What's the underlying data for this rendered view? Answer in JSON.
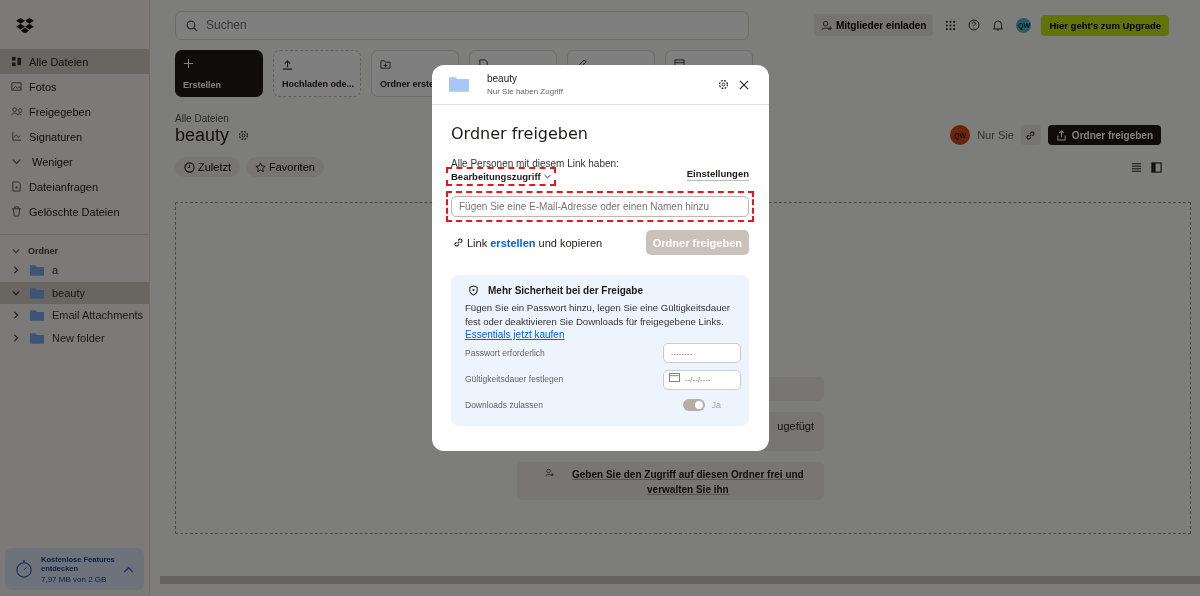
{
  "search": {
    "placeholder": "Suchen"
  },
  "top_actions": {
    "invite": "Mitglieder einladen",
    "avatar": "QW",
    "upgrade": "Hier geht's zum Upgrade"
  },
  "sidebar": {
    "nav": [
      {
        "label": "Alle Dateien",
        "selected": true
      },
      {
        "label": "Fotos",
        "selected": false
      },
      {
        "label": "Freigegeben",
        "selected": false
      },
      {
        "label": "Signaturen",
        "selected": false
      },
      {
        "label": "Weniger",
        "selected": false
      },
      {
        "label": "Dateianfragen",
        "selected": false
      },
      {
        "label": "Gelöschte Dateien",
        "selected": false
      }
    ],
    "folders_heading": "Ordner",
    "folders": [
      {
        "label": "a",
        "selected": false,
        "expanded": false
      },
      {
        "label": "beauty",
        "selected": true,
        "expanded": true
      },
      {
        "label": "Email Attachments",
        "selected": false,
        "expanded": false
      },
      {
        "label": "New folder",
        "selected": false,
        "expanded": false
      }
    ],
    "promo": {
      "title": "Kostenlose Features entdecken",
      "usage": "7,97 MB von 2 GB"
    }
  },
  "create_tiles": [
    {
      "label": "Erstellen",
      "kind": "primary"
    },
    {
      "label": "Hochladen ode...",
      "kind": "dashed"
    },
    {
      "label": "Ordner erste",
      "kind": "outline"
    },
    {
      "kind": "outline"
    },
    {
      "kind": "outline"
    },
    {
      "kind": "outline"
    }
  ],
  "breadcrumb": "Alle Dateien",
  "folder_title": "beauty",
  "sharing": {
    "avatar": "QW",
    "label": "Nur Sie",
    "button": "Ordner freigeben"
  },
  "filters": [
    {
      "label": "Zuletzt"
    },
    {
      "label": "Favoriten"
    }
  ],
  "empty_state": {
    "cards": [
      {
        "kind": "blank"
      },
      {
        "kind": "partial",
        "text": "ugefügt"
      },
      {
        "kind": "share",
        "text": "Geben Sie den Zugriff auf diesen Ordner frei und verwalten Sie ihn"
      }
    ]
  },
  "dialog": {
    "folder_name": "beauty",
    "access_note": "Nur Sie haben Zugriff",
    "title": "Ordner freigeben",
    "link_permission_label": "Alle Personen mit diesem Link haben:",
    "access": {
      "value": "Bearbeitungszugriff",
      "highlighted": true
    },
    "settings_link": "Einstellungen",
    "invite_field": {
      "placeholder": "Fügen Sie eine E-Mail-Adresse oder einen Namen hinzu",
      "highlighted": true
    },
    "link_row": {
      "prefix": "Link",
      "action": "erstellen",
      "suffix": "und kopieren"
    },
    "share_button": {
      "label": "Ordner freigeben",
      "disabled": true
    },
    "security": {
      "title": "Mehr Sicherheit bei der Freigabe",
      "text": "Fügen Sie ein Passwort hinzu, legen Sie eine Gültigkeitsdauer fest oder deaktivieren Sie Downloads für freigegebene Links.",
      "link": "Essentials jetzt kaufen",
      "options": [
        {
          "kind": "password",
          "label": "Passwort erforderlich",
          "placeholder": "--------"
        },
        {
          "kind": "date",
          "label": "Gültigkeitsdauer festlegen",
          "placeholder": "--/--/----"
        },
        {
          "kind": "toggle",
          "label": "Downloads zulassen",
          "on": true,
          "disabled": true,
          "value": "Ja"
        }
      ]
    }
  }
}
